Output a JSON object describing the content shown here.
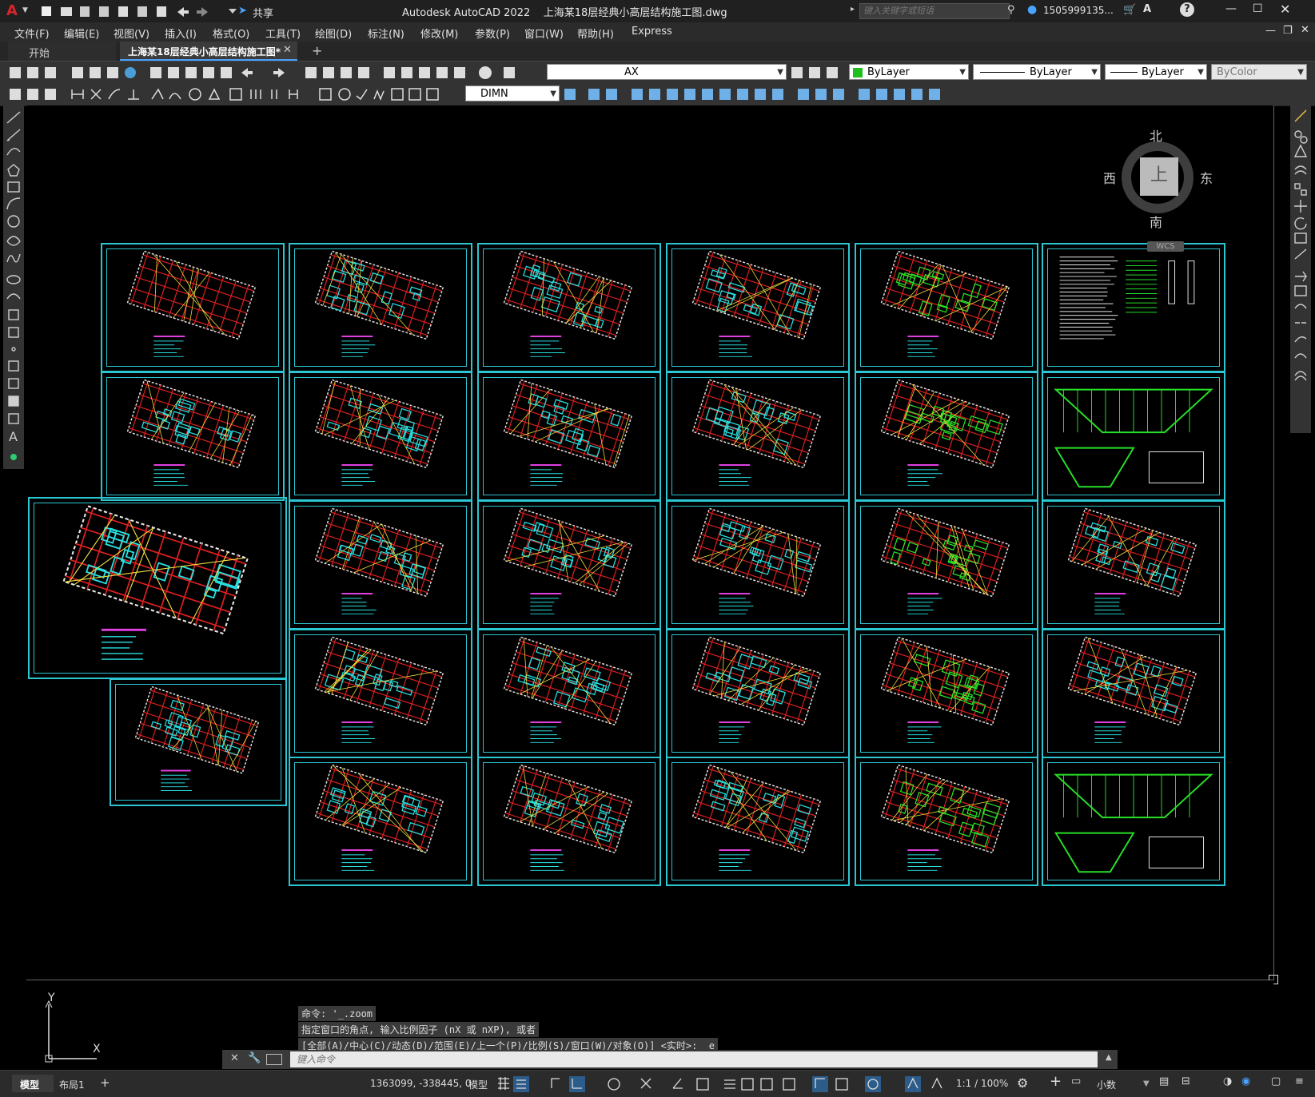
{
  "app": {
    "window_title": "Autodesk AutoCAD 2022    上海某18层经典小高层结构施工图.dwg",
    "share_label": "共享",
    "search_placeholder": "键入关键字或短语",
    "user": "1505999135...",
    "accent": "#c0392b"
  },
  "menu": [
    "文件(F)",
    "编辑(E)",
    "视图(V)",
    "插入(I)",
    "格式(O)",
    "工具(T)",
    "绘图(D)",
    "标注(N)",
    "修改(M)",
    "参数(P)",
    "窗口(W)",
    "帮助(H)",
    "Express"
  ],
  "tabs": [
    {
      "label": "开始",
      "active": false
    },
    {
      "label": "上海某18层经典小高层结构施工图*",
      "active": true
    }
  ],
  "toolbar": {
    "layer_value": "AX",
    "color_value": "ByLayer",
    "linetype_value": "ByLayer",
    "lineweight_value": "ByLayer",
    "plotstyle_value": "ByColor",
    "dimstyle_value": "DIMN"
  },
  "viewcube": {
    "north": "北",
    "south": "南",
    "east": "东",
    "west": "西",
    "face": "上",
    "wcs": "WCS"
  },
  "command": {
    "history": [
      "命令: '_.zoom",
      "指定窗口的角点, 输入比例因子 (nX 或 nXP), 或者",
      "[全部(A)/中心(C)/动态(D)/范围(E)/上一个(P)/比例(S)/窗口(W)/对象(O)] <实时>: _e"
    ],
    "placeholder": "键入命令"
  },
  "ucs": {
    "x": "X",
    "y": "Y"
  },
  "status": {
    "model_tab": "模型",
    "layout_tab": "布局1",
    "coords": "1363099, -338445, 0",
    "space": "模型",
    "scale": "1:1 / 100%",
    "units": "小数"
  },
  "colors": {
    "sheet_border": "#2cc6d2",
    "red": "#e02020",
    "cyan": "#28e0e0",
    "green": "#28e028",
    "white": "#e8e8e8",
    "yellow": "#f0e040",
    "magenta": "#e040e0"
  }
}
